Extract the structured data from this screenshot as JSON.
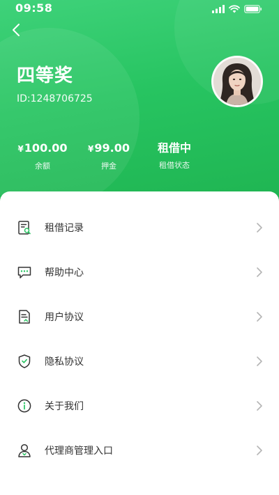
{
  "status_bar": {
    "time": "09:58",
    "icons": [
      "signal-icon",
      "wifi-icon",
      "battery-icon"
    ]
  },
  "header": {
    "back_icon": "chevron-left-icon",
    "user_name": "四等奖",
    "user_id": "ID:1248706725"
  },
  "stats": {
    "currency_symbol": "¥",
    "balance_value": "100.00",
    "balance_label": "余额",
    "deposit_value": "99.00",
    "deposit_label": "押金",
    "status_value": "租借中",
    "status_label": "租借状态"
  },
  "menu": {
    "items": [
      {
        "label": "租借记录",
        "icon": "document-search-icon"
      },
      {
        "label": "帮助中心",
        "icon": "chat-bubble-icon"
      },
      {
        "label": "用户协议",
        "icon": "document-icon"
      },
      {
        "label": "隐私协议",
        "icon": "shield-icon"
      },
      {
        "label": "关于我们",
        "icon": "info-icon"
      },
      {
        "label": "代理商管理入口",
        "icon": "user-icon"
      }
    ]
  },
  "colors": {
    "header_green": "#27c461",
    "text_dark": "#333333",
    "chevron_gray": "#b5b5b5"
  }
}
